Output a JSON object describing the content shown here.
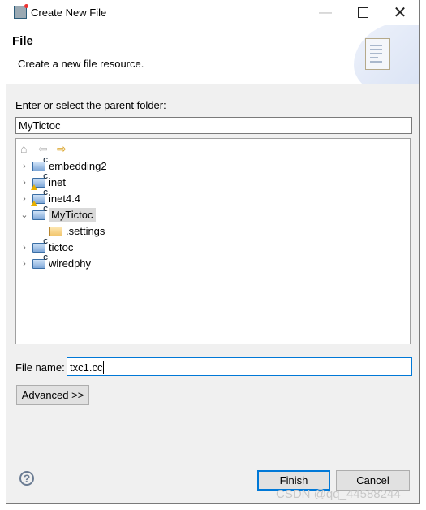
{
  "window": {
    "title": "Create New File",
    "icon": "eclipse-wizard-icon"
  },
  "header": {
    "title": "File",
    "description": "Create a new file resource.",
    "icon": "new-file-icon"
  },
  "parent_folder": {
    "label": "Enter or select the parent folder:",
    "value": "MyTictoc"
  },
  "tree_toolbar": [
    "home-icon",
    "back-icon",
    "forward-icon"
  ],
  "tree": [
    {
      "label": "embedding2",
      "expanded": false,
      "warning": false,
      "indent": 0
    },
    {
      "label": "inet",
      "expanded": false,
      "warning": true,
      "indent": 0
    },
    {
      "label": "inet4.4",
      "expanded": false,
      "warning": true,
      "indent": 0
    },
    {
      "label": "MyTictoc",
      "expanded": true,
      "warning": false,
      "indent": 0,
      "selected": true
    },
    {
      "label": ".settings",
      "folder": true,
      "indent": 1
    },
    {
      "label": "tictoc",
      "expanded": false,
      "warning": false,
      "indent": 0
    },
    {
      "label": "wiredphy",
      "expanded": false,
      "warning": false,
      "indent": 0
    }
  ],
  "file_name": {
    "label": "File name:",
    "value": "txc1.cc"
  },
  "buttons": {
    "advanced": "Advanced >>",
    "finish": "Finish",
    "cancel": "Cancel"
  },
  "watermark": "CSDN @qq_44588244",
  "colors": {
    "focus": "#0078d7",
    "selection": "#d9d9d9",
    "body": "#f0f0f0"
  }
}
